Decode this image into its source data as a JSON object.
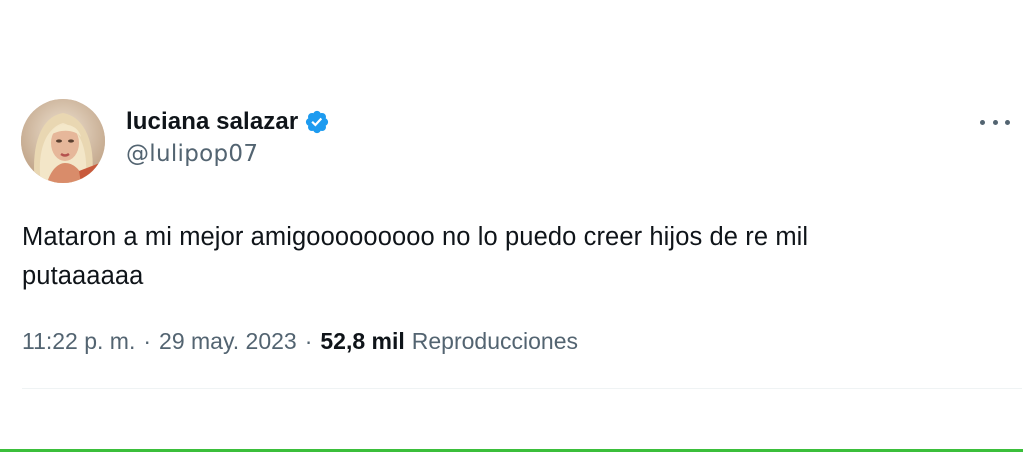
{
  "tweet": {
    "author": {
      "display_name": "luciana salazar",
      "handle": "@lulipop07",
      "verified": true,
      "avatar_icon": "profile-photo"
    },
    "text_line1": "Mataron a mi mejor amigooooooooo no lo puedo creer hijos de re mil",
    "text_line2": "putaaaaaa",
    "time": "11:22 p. m.",
    "separator": "·",
    "date": "29 may. 2023",
    "views_count": "52,8 mil",
    "views_label": "Reproducciones",
    "more_icon": "ellipsis-icon"
  },
  "colors": {
    "verified_blue": "#1d9bf0",
    "secondary_text": "#536471",
    "primary_text": "#0f1419",
    "bottom_accent": "#3bbf3b"
  }
}
